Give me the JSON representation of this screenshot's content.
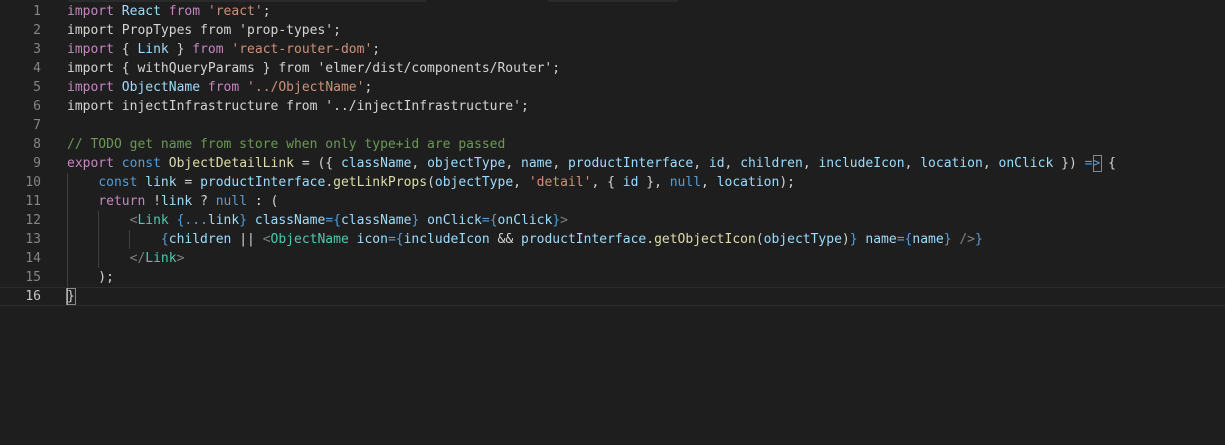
{
  "colors": {
    "background": "#1e1e1e",
    "keyword": "#c586c0",
    "storage": "#569cd6",
    "variable": "#9cdcfe",
    "function": "#dcdcaa",
    "string": "#ce9178",
    "comment": "#6a9955",
    "text": "#d4d4d4",
    "tag": "#569cd6",
    "tagBracket": "#808080",
    "component": "#4ec9b0"
  },
  "editor": {
    "current_line": "16",
    "lines": [
      {
        "number": "1",
        "tokens": [
          {
            "t": "import",
            "c": "keyword"
          },
          {
            "t": " ",
            "c": "text"
          },
          {
            "t": "React",
            "c": "variable"
          },
          {
            "t": " ",
            "c": "text"
          },
          {
            "t": "from",
            "c": "keyword"
          },
          {
            "t": " ",
            "c": "text"
          },
          {
            "t": "'react'",
            "c": "string"
          },
          {
            "t": ";",
            "c": "text"
          }
        ]
      },
      {
        "number": "2",
        "tokens": [
          {
            "t": "import PropTypes from 'prop-types';",
            "c": "text"
          }
        ]
      },
      {
        "number": "3",
        "tokens": [
          {
            "t": "import",
            "c": "keyword"
          },
          {
            "t": " { ",
            "c": "text"
          },
          {
            "t": "Link",
            "c": "variable"
          },
          {
            "t": " } ",
            "c": "text"
          },
          {
            "t": "from",
            "c": "keyword"
          },
          {
            "t": " ",
            "c": "text"
          },
          {
            "t": "'react-router-dom'",
            "c": "string"
          },
          {
            "t": ";",
            "c": "text"
          }
        ]
      },
      {
        "number": "4",
        "tokens": [
          {
            "t": "import { withQueryParams } from 'elmer/dist/components/Router';",
            "c": "text"
          }
        ]
      },
      {
        "number": "5",
        "tokens": [
          {
            "t": "import",
            "c": "keyword"
          },
          {
            "t": " ",
            "c": "text"
          },
          {
            "t": "ObjectName",
            "c": "variable"
          },
          {
            "t": " ",
            "c": "text"
          },
          {
            "t": "from",
            "c": "keyword"
          },
          {
            "t": " ",
            "c": "text"
          },
          {
            "t": "'../ObjectName'",
            "c": "string"
          },
          {
            "t": ";",
            "c": "text"
          }
        ]
      },
      {
        "number": "6",
        "tokens": [
          {
            "t": "import injectInfrastructure from '../injectInfrastructure';",
            "c": "text"
          }
        ]
      },
      {
        "number": "7",
        "tokens": []
      },
      {
        "number": "8",
        "tokens": [
          {
            "t": "// TODO get name from store when only type+id are passed",
            "c": "comment"
          }
        ]
      },
      {
        "number": "9",
        "tokens": [
          {
            "t": "export",
            "c": "keyword"
          },
          {
            "t": " ",
            "c": "text"
          },
          {
            "t": "const",
            "c": "storage"
          },
          {
            "t": " ",
            "c": "text"
          },
          {
            "t": "ObjectDetailLink",
            "c": "function"
          },
          {
            "t": " = ({ ",
            "c": "text"
          },
          {
            "t": "className",
            "c": "variable"
          },
          {
            "t": ", ",
            "c": "text"
          },
          {
            "t": "objectType",
            "c": "variable"
          },
          {
            "t": ", ",
            "c": "text"
          },
          {
            "t": "name",
            "c": "variable"
          },
          {
            "t": ", ",
            "c": "text"
          },
          {
            "t": "productInterface",
            "c": "variable"
          },
          {
            "t": ", ",
            "c": "text"
          },
          {
            "t": "id",
            "c": "variable"
          },
          {
            "t": ", ",
            "c": "text"
          },
          {
            "t": "children",
            "c": "variable"
          },
          {
            "t": ", ",
            "c": "text"
          },
          {
            "t": "includeIcon",
            "c": "variable"
          },
          {
            "t": ", ",
            "c": "text"
          },
          {
            "t": "location",
            "c": "variable"
          },
          {
            "t": ", ",
            "c": "text"
          },
          {
            "t": "onClick",
            "c": "variable"
          },
          {
            "t": " }) ",
            "c": "text"
          },
          {
            "t": "=>",
            "c": "storage"
          },
          {
            "t": " {",
            "c": "text"
          }
        ]
      },
      {
        "number": "10",
        "tokens": [
          {
            "t": "    ",
            "c": "text"
          },
          {
            "t": "const",
            "c": "storage"
          },
          {
            "t": " ",
            "c": "text"
          },
          {
            "t": "link",
            "c": "variable"
          },
          {
            "t": " = ",
            "c": "text"
          },
          {
            "t": "productInterface",
            "c": "variable"
          },
          {
            "t": ".",
            "c": "text"
          },
          {
            "t": "getLinkProps",
            "c": "function"
          },
          {
            "t": "(",
            "c": "text"
          },
          {
            "t": "objectType",
            "c": "variable"
          },
          {
            "t": ", ",
            "c": "text"
          },
          {
            "t": "'detail'",
            "c": "string"
          },
          {
            "t": ", { ",
            "c": "text"
          },
          {
            "t": "id",
            "c": "variable"
          },
          {
            "t": " }, ",
            "c": "text"
          },
          {
            "t": "null",
            "c": "storage"
          },
          {
            "t": ", ",
            "c": "text"
          },
          {
            "t": "location",
            "c": "variable"
          },
          {
            "t": ");",
            "c": "text"
          }
        ]
      },
      {
        "number": "11",
        "tokens": [
          {
            "t": "    ",
            "c": "text"
          },
          {
            "t": "return",
            "c": "keyword"
          },
          {
            "t": " !",
            "c": "text"
          },
          {
            "t": "link",
            "c": "variable"
          },
          {
            "t": " ? ",
            "c": "text"
          },
          {
            "t": "null",
            "c": "storage"
          },
          {
            "t": " : (",
            "c": "text"
          }
        ]
      },
      {
        "number": "12",
        "tokens": [
          {
            "t": "        ",
            "c": "text"
          },
          {
            "t": "<",
            "c": "tagBracket"
          },
          {
            "t": "Link",
            "c": "component"
          },
          {
            "t": " {...",
            "c": "storage"
          },
          {
            "t": "link",
            "c": "variable"
          },
          {
            "t": "} ",
            "c": "storage"
          },
          {
            "t": "className",
            "c": "variable"
          },
          {
            "t": "={",
            "c": "storage"
          },
          {
            "t": "className",
            "c": "variable"
          },
          {
            "t": "} ",
            "c": "storage"
          },
          {
            "t": "onClick",
            "c": "variable"
          },
          {
            "t": "={",
            "c": "storage"
          },
          {
            "t": "onClick",
            "c": "variable"
          },
          {
            "t": "}",
            "c": "storage"
          },
          {
            "t": ">",
            "c": "tagBracket"
          }
        ]
      },
      {
        "number": "13",
        "tokens": [
          {
            "t": "            ",
            "c": "text"
          },
          {
            "t": "{",
            "c": "storage"
          },
          {
            "t": "children",
            "c": "variable"
          },
          {
            "t": " || ",
            "c": "text"
          },
          {
            "t": "<",
            "c": "tagBracket"
          },
          {
            "t": "ObjectName",
            "c": "component"
          },
          {
            "t": " ",
            "c": "text"
          },
          {
            "t": "icon",
            "c": "variable"
          },
          {
            "t": "={",
            "c": "storage"
          },
          {
            "t": "includeIcon",
            "c": "variable"
          },
          {
            "t": " && ",
            "c": "text"
          },
          {
            "t": "productInterface",
            "c": "variable"
          },
          {
            "t": ".",
            "c": "text"
          },
          {
            "t": "getObjectIcon",
            "c": "function"
          },
          {
            "t": "(",
            "c": "text"
          },
          {
            "t": "objectType",
            "c": "variable"
          },
          {
            "t": ")",
            "c": "text"
          },
          {
            "t": "} ",
            "c": "storage"
          },
          {
            "t": "name",
            "c": "variable"
          },
          {
            "t": "={",
            "c": "storage"
          },
          {
            "t": "name",
            "c": "variable"
          },
          {
            "t": "} ",
            "c": "storage"
          },
          {
            "t": "/>",
            "c": "tagBracket"
          },
          {
            "t": "}",
            "c": "storage"
          }
        ]
      },
      {
        "number": "14",
        "tokens": [
          {
            "t": "        ",
            "c": "text"
          },
          {
            "t": "</",
            "c": "tagBracket"
          },
          {
            "t": "Link",
            "c": "component"
          },
          {
            "t": ">",
            "c": "tagBracket"
          }
        ]
      },
      {
        "number": "15",
        "tokens": [
          {
            "t": "    );",
            "c": "text"
          }
        ]
      },
      {
        "number": "16",
        "tokens": [
          {
            "t": "}",
            "c": "text"
          }
        ]
      }
    ]
  }
}
